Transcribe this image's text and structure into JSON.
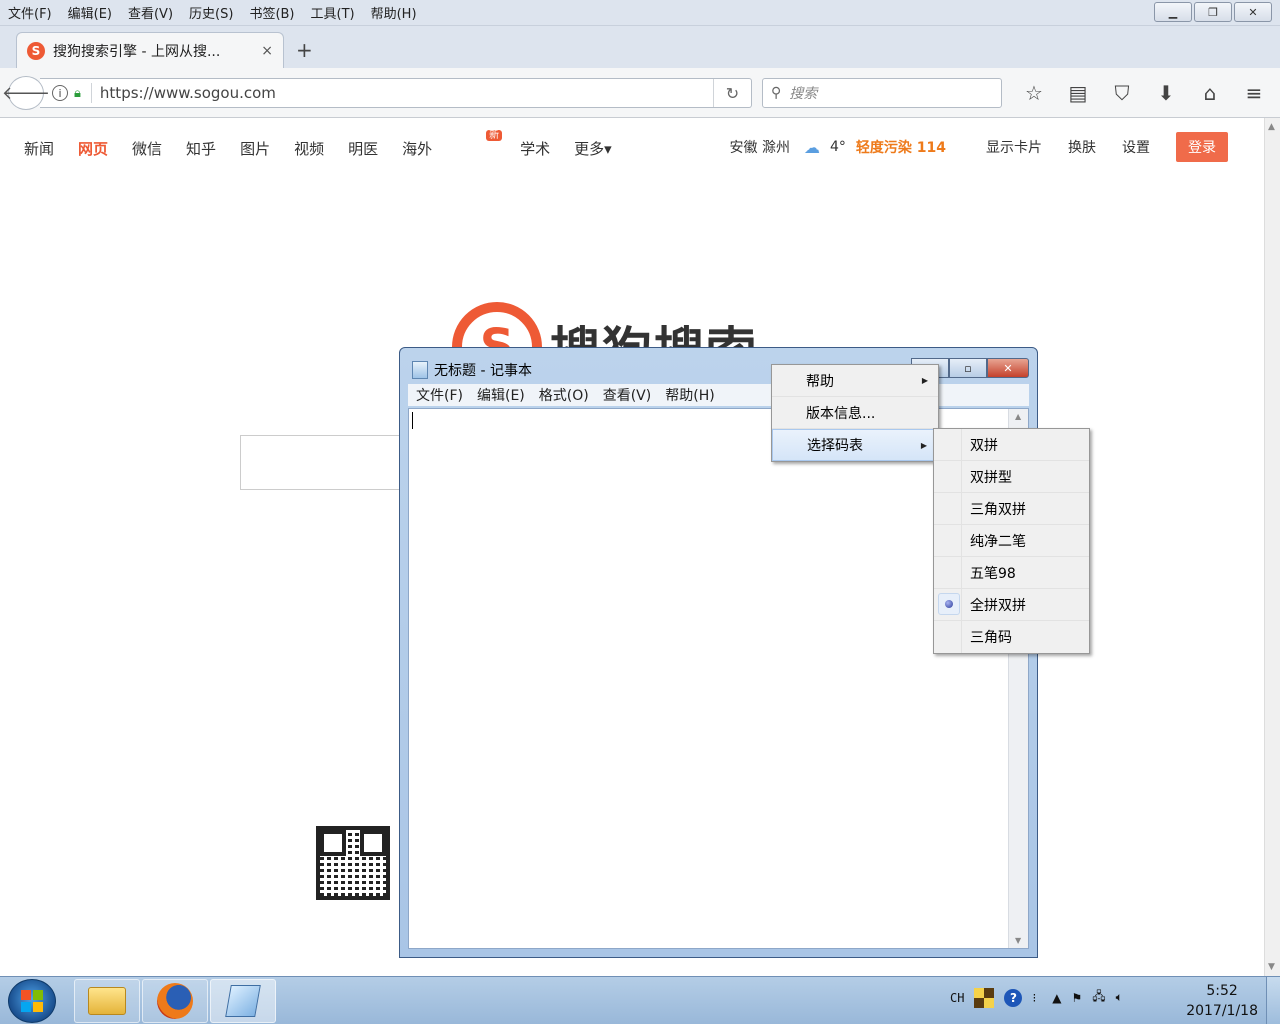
{
  "browser": {
    "menu": [
      "文件(F)",
      "编辑(E)",
      "查看(V)",
      "历史(S)",
      "书签(B)",
      "工具(T)",
      "帮助(H)"
    ],
    "window_buttons": {
      "minimize": "▁",
      "restore": "❐",
      "close": "✕"
    },
    "tab": {
      "favicon": "S",
      "title": "搜狗搜索引擎 - 上网从搜...",
      "close": "×"
    },
    "new_tab": "+",
    "url": "https://www.sogou.com",
    "search_placeholder": "搜索",
    "icons": [
      "star-icon",
      "reader-icon",
      "pocket-icon",
      "download-icon",
      "home-icon",
      "menu-icon"
    ]
  },
  "sogou": {
    "nav": [
      "新闻",
      "网页",
      "微信",
      "知乎",
      "图片",
      "视频",
      "明医",
      "海外",
      "学术",
      "更多▾"
    ],
    "new_badge": "新",
    "weather": {
      "city": "安徽 滁州",
      "temp": "4°",
      "pollution": "轻度污染 114"
    },
    "links": [
      "显示卡片",
      "换肤",
      "设置"
    ],
    "login": "登录",
    "logo_mark": "S",
    "logo_text": "搜狗搜索"
  },
  "notepad": {
    "title": "无标题 - 记事本",
    "menu": [
      "文件(F)",
      "编辑(E)",
      "格式(O)",
      "查看(V)",
      "帮助(H)"
    ],
    "window_buttons": {
      "minimize": "—",
      "maximize": "▫",
      "close": "✕"
    }
  },
  "context_menu": {
    "items": [
      {
        "label": "帮助",
        "submenu": true
      },
      {
        "label": "版本信息...",
        "submenu": false
      },
      {
        "label": "选择码表",
        "submenu": true
      }
    ]
  },
  "submenu": {
    "items": [
      "双拼",
      "双拼型",
      "三角双拼",
      "纯净二笔",
      "五笔98",
      "全拼双拼",
      "三角码"
    ],
    "selected_index": 5
  },
  "taskbar": {
    "tray_lang": "CH",
    "time": "5:52",
    "date": "2017/1/18"
  }
}
